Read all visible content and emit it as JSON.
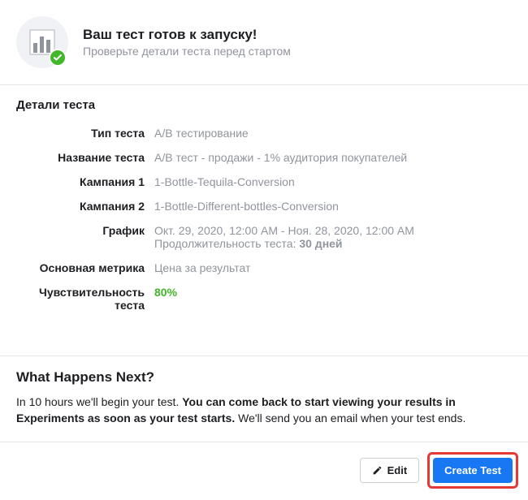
{
  "header": {
    "title": "Ваш тест готов к запуску!",
    "subtitle": "Проверьте детали теста перед стартом"
  },
  "details": {
    "section_title": "Детали теста",
    "rows": {
      "test_type": {
        "label": "Тип теста",
        "value": "A/B тестирование"
      },
      "test_name": {
        "label": "Название теста",
        "value": "A/B тест - продажи - 1% аудитория покупателей"
      },
      "campaign1": {
        "label": "Кампания 1",
        "value": "1-Bottle-Tequila-Conversion"
      },
      "campaign2": {
        "label": "Кампания 2",
        "value": "1-Bottle-Different-bottles-Conversion"
      },
      "schedule": {
        "label": "График",
        "range": "Окт. 29, 2020, 12:00 AM - Ноя. 28, 2020, 12:00 AM",
        "duration_prefix": "Продолжительность теста: ",
        "duration_value": "30 дней"
      },
      "key_metric": {
        "label": "Основная метрика",
        "value": "Цена за результат"
      },
      "sensitivity": {
        "label": "Чувствительность теста",
        "value": "80%"
      }
    }
  },
  "next": {
    "title": "What Happens Next?",
    "lead": "In 10 hours we'll begin your test. ",
    "bold": "You can come back to start viewing your results in Experiments as soon as your test starts.",
    "tail": " We'll send you an email when your test ends."
  },
  "footer": {
    "edit_label": "Edit",
    "create_label": "Create Test"
  }
}
